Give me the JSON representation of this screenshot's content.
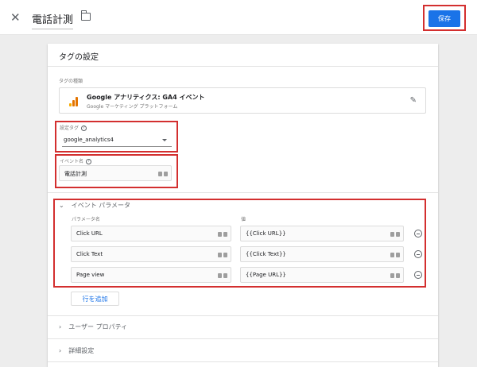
{
  "header": {
    "close_icon": "close-icon",
    "title": "電話計測",
    "folder_icon": "folder-icon",
    "save_label": "保存",
    "accent": "#1a73e8",
    "highlight": "#d32f2f"
  },
  "card": {
    "title": "タグの設定",
    "tag_type_label": "タグの種類",
    "tag_type_name": "Google アナリティクス: GA4 イベント",
    "tag_type_sub": "Google マーケティング プラットフォーム",
    "config_tag_label": "設定タグ",
    "config_tag_value": "google_analytics4",
    "event_name_label": "イベント名",
    "event_name_value": "電話計測",
    "event_params_header": "イベント パラメータ",
    "param_name_col": "パラメータ名",
    "value_col": "値",
    "params": [
      {
        "name": "Click URL",
        "value": "{{Click URL}}"
      },
      {
        "name": "Click Text",
        "value": "{{Click Text}}"
      },
      {
        "name": "Page view",
        "value": "{{Page URL}}"
      }
    ],
    "add_row_label": "行を追加",
    "user_props_header": "ユーザー プロパティ",
    "advanced_header": "詳細設定",
    "help_glyph": "?"
  }
}
